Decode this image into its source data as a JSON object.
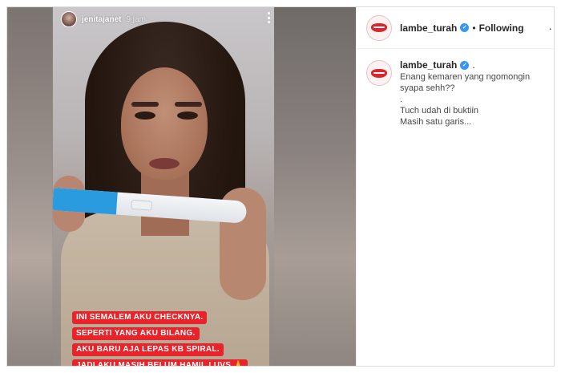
{
  "story": {
    "username": "jenitajanet",
    "time": "9 jam",
    "caption_lines": [
      "INI SEMALEM AKU CHECKNYA.",
      "SEPERTI YANG AKU BILANG.",
      "AKU BARU AJA LEPAS KB SPIRAL.",
      "JADI AKU MASIH BELUM HAMIL LUVS 🙏"
    ],
    "caption_color": "#e8232a"
  },
  "post": {
    "author": "lambe_turah",
    "verified_icon": "verified-badge-icon",
    "follow_status": "Following",
    "separator": "•",
    "more_glyph": "·"
  },
  "comment": {
    "author": "lambe_turah",
    "trailing": ".",
    "lines": [
      "Enang kemaren yang ngomongin",
      "syapa sehh??",
      ".",
      "Tuch udah di buktiin",
      "Masih satu garis..."
    ]
  },
  "colors": {
    "verified": "#3897f0",
    "brand_red": "#d9252b"
  }
}
